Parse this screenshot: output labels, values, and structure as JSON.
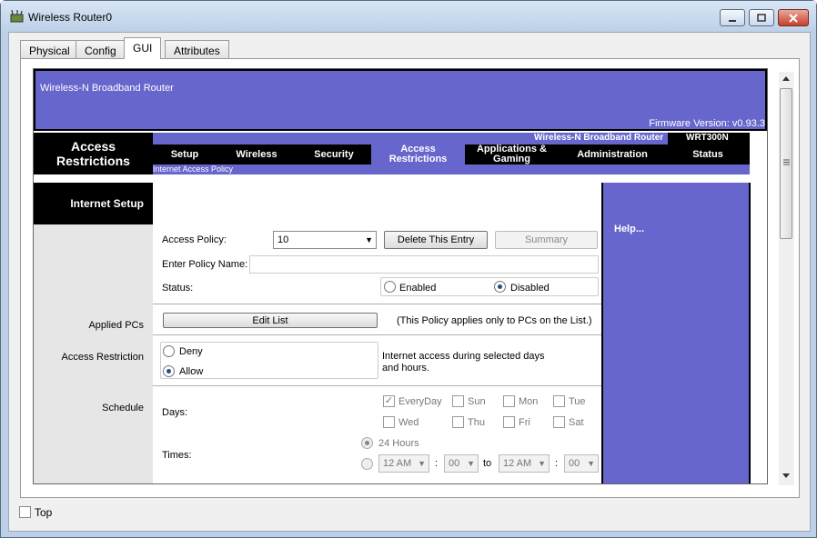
{
  "window": {
    "title": "Wireless Router0",
    "tabs": [
      "Physical",
      "Config",
      "GUI",
      "Attributes"
    ],
    "active_tab": "GUI",
    "top_label": "Top"
  },
  "router": {
    "product_name": "Wireless-N Broadband Router",
    "firmware": "Firmware Version: v0.93.3",
    "model_name": "Wireless-N Broadband Router",
    "model_number": "WRT300N",
    "section_title": "Access Restrictions",
    "nav": [
      "Setup",
      "Wireless",
      "Security",
      "Access Restrictions",
      "Applications & Gaming",
      "Administration",
      "Status"
    ],
    "active_nav": "Access Restrictions",
    "subnav": "Internet Access Policy"
  },
  "left": {
    "header": "Internet Setup",
    "applied_pcs": "Applied PCs",
    "access_restriction": "Access Restriction",
    "schedule": "Schedule"
  },
  "form": {
    "access_policy_label": "Access Policy:",
    "access_policy_value": "10",
    "delete_button": "Delete This Entry",
    "summary_button": "Summary",
    "policy_name_label": "Enter Policy Name:",
    "policy_name_value": "",
    "status_label": "Status:",
    "enabled": "Enabled",
    "disabled": "Disabled",
    "status_selected": "Disabled",
    "edit_list_button": "Edit List",
    "edit_list_note": "(This Policy applies only to PCs on the List.)",
    "deny": "Deny",
    "allow": "Allow",
    "restriction_selected": "Allow",
    "restriction_note_1": "Internet access during selected days",
    "restriction_note_2": "and hours.",
    "days_label": "Days:",
    "days": [
      "EveryDay",
      "Sun",
      "Mon",
      "Tue",
      "Wed",
      "Thu",
      "Fri",
      "Sat"
    ],
    "everyday_checked": true,
    "times_label": "Times:",
    "hours_24": "24 Hours",
    "start_hour": "12 AM",
    "start_min": "00",
    "to": "to",
    "end_hour": "12 AM",
    "end_min": "00",
    "colon": ":"
  },
  "help": {
    "label": "Help..."
  }
}
